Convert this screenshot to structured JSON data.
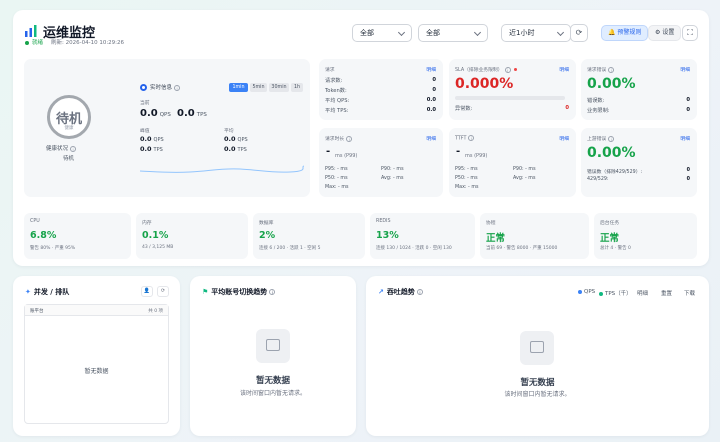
{
  "header": {
    "title": "运维监控",
    "status": "就绪",
    "refresh": "刷新: 2026-04-10 10:29:26",
    "filter1": "全部",
    "filter2": "全部",
    "time_range": "近1小时",
    "alert_rules": "预警规则",
    "settings": "设置"
  },
  "health": {
    "ring_main": "待机",
    "ring_sub": "健康",
    "label": "健康状况",
    "value": "待机"
  },
  "realtime": {
    "label": "实时信息",
    "segments": [
      "1min",
      "5min",
      "30min",
      "1h"
    ],
    "current_label": "当前",
    "current_qps": "0.0",
    "current_tps": "0.0",
    "peak_label": "峰值",
    "peak_qps": "0.0",
    "peak_tps": "0.0",
    "avg_label": "平均",
    "avg_qps": "0.0",
    "avg_tps": "0.0",
    "unit_qps": "QPS",
    "unit_tps": "TPS"
  },
  "requests": {
    "title": "请求",
    "link": "明细",
    "rows": [
      {
        "k": "请求数:",
        "v": "0"
      },
      {
        "k": "Token数:",
        "v": "0"
      },
      {
        "k": "平均 QPS:",
        "v": "0.0"
      },
      {
        "k": "平均 TPS:",
        "v": "0.0"
      }
    ]
  },
  "sla": {
    "title": "SLA（排除业务限制）",
    "link": "明细",
    "value": "0.000%",
    "row_k": "异常数:",
    "row_v": "0"
  },
  "req_error": {
    "title": "请求错误",
    "link": "明细",
    "value": "0.00%",
    "rows": [
      {
        "k": "错误数:",
        "v": "0"
      },
      {
        "k": "业务限制:",
        "v": "0"
      }
    ]
  },
  "duration": {
    "title": "请求时长",
    "link": "明细",
    "dash": "-",
    "unit": "ms (P99)",
    "rows_left": [
      "P95: - ms",
      "P50: - ms",
      "Max: - ms"
    ],
    "rows_right": [
      "P90: - ms",
      "Avg: - ms"
    ]
  },
  "ttft": {
    "title": "TTFT",
    "link": "明细",
    "dash": "-",
    "unit": "ms (P99)",
    "rows_left": [
      "P95: - ms",
      "P50: - ms",
      "Max: - ms"
    ],
    "rows_right": [
      "P90: - ms",
      "Avg: - ms"
    ]
  },
  "upstream": {
    "title": "上游错误",
    "link": "明细",
    "value": "0.00%",
    "row1_k": "错误数（排除429/529）:",
    "row1_v": "0",
    "row2_k": "429/529:",
    "row2_v": "0"
  },
  "resources": [
    {
      "title": "CPU",
      "value": "6.8%",
      "sub": "警告 80% · 严重 95%"
    },
    {
      "title": "内存",
      "value": "0.1%",
      "sub": "43 / 3,125 MB"
    },
    {
      "title": "数据库",
      "value": "2%",
      "sub": "连接 6 / 200 · 活跃 1 · 空闲 5"
    },
    {
      "title": "REDIS",
      "value": "13%",
      "sub": "连接 130 / 1024 · 活跃 0 · 空闲 130"
    },
    {
      "title": "协程",
      "value": "正常",
      "sub": "当前 69 · 警告 8000 · 严重 15000"
    },
    {
      "title": "后台任务",
      "value": "正常",
      "sub": "总计 4 · 警告 0"
    }
  ],
  "concurrency": {
    "title": "并发 / 排队",
    "col_left": "账平台",
    "col_right": "共 0 项",
    "empty": "暂无数据"
  },
  "switch_trend": {
    "title": "平均账号切换趋势",
    "empty": "暂无数据",
    "hint": "该时间窗口内暂无请求。"
  },
  "throughput": {
    "title": "吞吐趋势",
    "legend_qps": "QPS",
    "legend_tps": "TPS（千）",
    "tabs": [
      "明细",
      "重置",
      "下载"
    ],
    "empty": "暂无数据",
    "hint": "该时间窗口内暂无请求。",
    "color_qps": "#3b82f6",
    "color_tps": "#10b981"
  }
}
